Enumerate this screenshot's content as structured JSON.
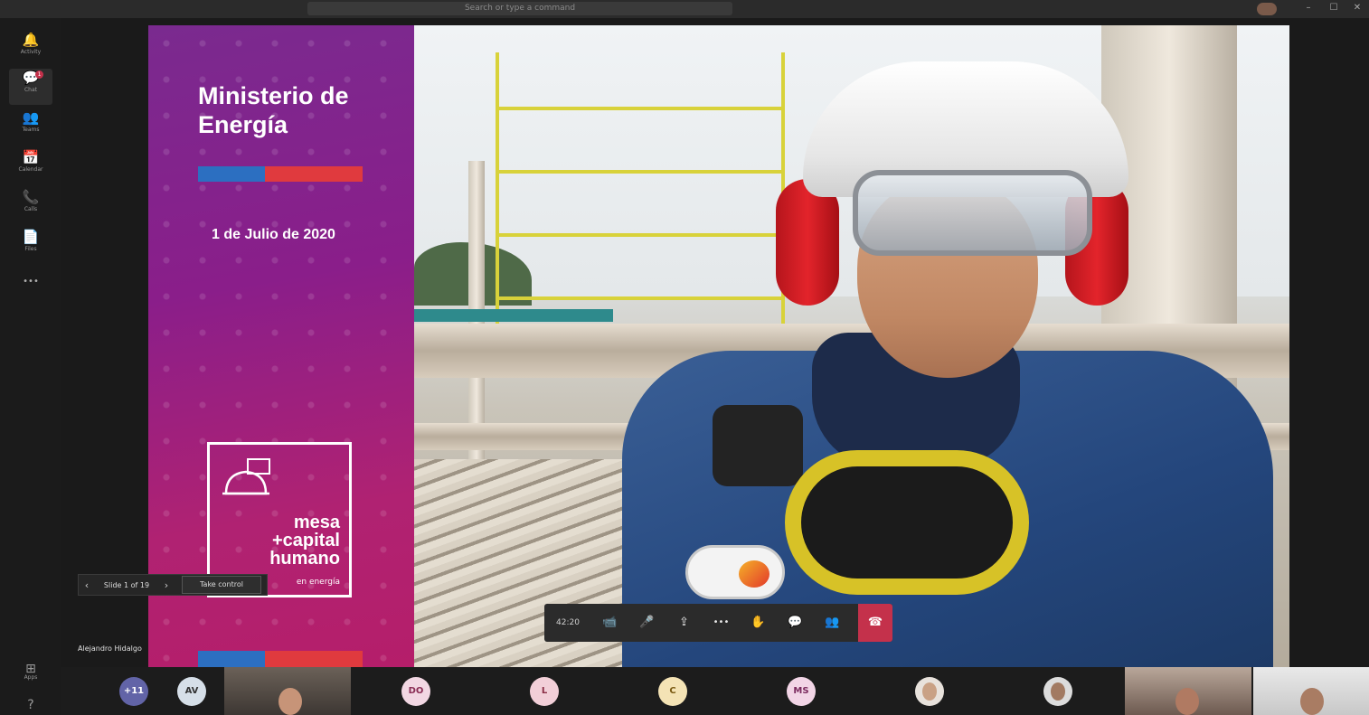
{
  "titlebar": {
    "search_placeholder": "Search or type a command",
    "controls": [
      "–",
      "☐",
      "✕"
    ]
  },
  "rail": {
    "items": [
      {
        "icon": "bell-icon",
        "glyph": "🔔",
        "label": "Activity"
      },
      {
        "icon": "chat-icon",
        "glyph": "💬",
        "label": "Chat",
        "badge": "1"
      },
      {
        "icon": "teams-icon",
        "glyph": "👥",
        "label": "Teams"
      },
      {
        "icon": "calendar-icon",
        "glyph": "📅",
        "label": "Calendar"
      },
      {
        "icon": "phone-icon",
        "glyph": "📞",
        "label": "Calls"
      },
      {
        "icon": "files-icon",
        "glyph": "📄",
        "label": "Files"
      },
      {
        "icon": "more-icon",
        "glyph": "•••",
        "label": ""
      }
    ],
    "apps_label": "Apps",
    "apps_glyph": "⊞",
    "help_glyph": "?"
  },
  "slide": {
    "title": "Ministerio de Energía",
    "date": "1 de Julio de 2020",
    "logo_text": [
      "mesa",
      "+capital",
      "humano"
    ],
    "logo_sub": "en energía"
  },
  "presenter": {
    "name": "Alejandro Hidalgo",
    "slide_counter": "Slide 1 of 19",
    "take_control": "Take control"
  },
  "callbar": {
    "timer": "42:20",
    "buttons": [
      {
        "name": "camera-button",
        "glyph": "📹"
      },
      {
        "name": "mic-button",
        "glyph": "🎤"
      },
      {
        "name": "share-button",
        "glyph": "⇪"
      },
      {
        "name": "more-actions-button",
        "glyph": "•••"
      },
      {
        "name": "raise-hand-button",
        "glyph": "✋"
      },
      {
        "name": "chat-button",
        "glyph": "💬"
      },
      {
        "name": "participants-button",
        "glyph": "👥"
      }
    ],
    "hangup_glyph": "☎"
  },
  "participants": [
    {
      "initials": "+11",
      "color": "#6264a7",
      "text": "#ffffff"
    },
    {
      "initials": "AV",
      "color": "#d6dfe8",
      "text": "#333333"
    },
    {
      "initials": "DO",
      "color": "#f2d7e3",
      "text": "#8a2d55"
    },
    {
      "initials": "L",
      "color": "#f2cfd8",
      "text": "#8a2d45"
    },
    {
      "initials": "C",
      "color": "#f4e3b5",
      "text": "#7a5a12"
    },
    {
      "initials": "MS",
      "color": "#f2d5e6",
      "text": "#7a2a5e"
    }
  ],
  "colors": {
    "accent": "#6264a7",
    "hangup": "#c4314b",
    "slide_purple": "#8a1e8a",
    "flag_blue": "#2c6fc1",
    "flag_red": "#e03a3e"
  }
}
